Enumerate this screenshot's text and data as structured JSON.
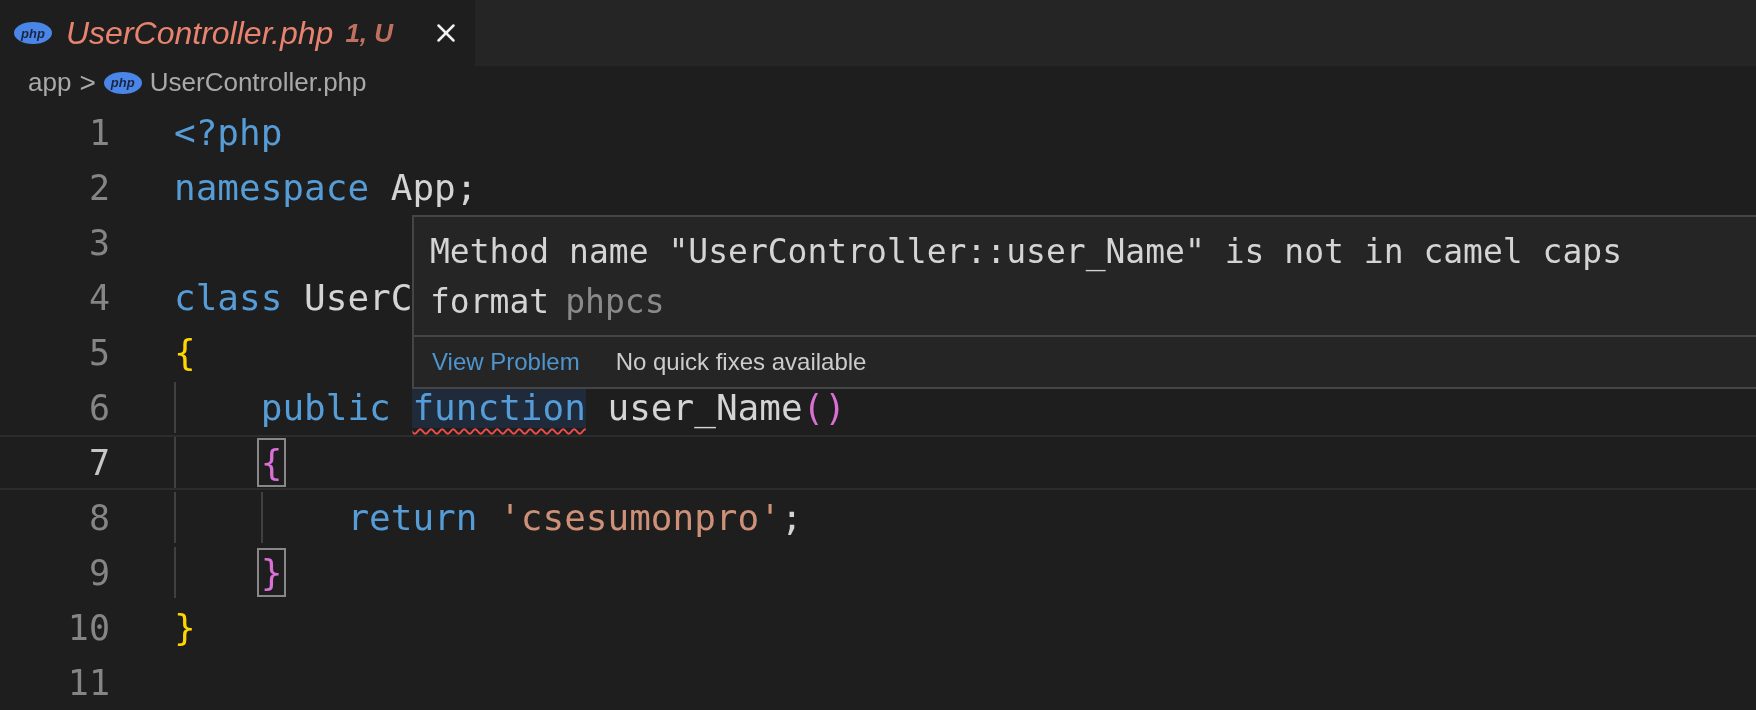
{
  "tab": {
    "icon_text": "php",
    "label": "UserController.php",
    "badge": "1, U",
    "selected": true
  },
  "breadcrumb": {
    "items": [
      {
        "label": "app",
        "kind": "folder"
      },
      {
        "label": "UserController.php",
        "kind": "file",
        "icon_text": "php"
      }
    ],
    "separator": ">"
  },
  "lines": [
    {
      "number": "1",
      "active": false,
      "tokens": [
        {
          "text": "<?php",
          "kind": "keyword"
        }
      ]
    },
    {
      "number": "2",
      "active": false,
      "tokens": [
        {
          "text": "namespace",
          "kind": "keyword"
        },
        {
          "text": " App;",
          "kind": "plain"
        }
      ]
    },
    {
      "number": "3",
      "active": false
    },
    {
      "number": "4",
      "active": false,
      "tokens": [
        {
          "text": "class",
          "kind": "keyword"
        },
        {
          "text": " UserC",
          "kind": "plain"
        }
      ]
    },
    {
      "number": "5",
      "active": false,
      "tokens": [
        {
          "text": "{",
          "kind": "brace-outer"
        }
      ]
    },
    {
      "number": "6",
      "active": false,
      "tokens": [
        {
          "text": "    public",
          "kind": "keyword"
        },
        {
          "text": " function",
          "kind": "keyword",
          "error": true
        },
        {
          "text": " user_Name",
          "kind": "plain"
        },
        {
          "text": "()",
          "kind": "brace-inner"
        }
      ]
    },
    {
      "number": "7",
      "active": true,
      "tokens": [
        {
          "text": "    {",
          "kind": "brace-inner",
          "matched": true
        }
      ]
    },
    {
      "number": "8",
      "active": false,
      "tokens": [
        {
          "text": "        return",
          "kind": "keyword"
        },
        {
          "text": " 'csesumonpro'",
          "kind": "string"
        },
        {
          "text": ";",
          "kind": "plain"
        }
      ]
    },
    {
      "number": "9",
      "active": false,
      "tokens": [
        {
          "text": "    }",
          "kind": "brace-inner",
          "matched": true
        }
      ]
    },
    {
      "number": "10",
      "active": false,
      "tokens": [
        {
          "text": "}",
          "kind": "brace-outer"
        }
      ]
    },
    {
      "number": "11",
      "active": false
    }
  ],
  "hover": {
    "message": "Method name \"UserController::user_Name\" is not in camel caps format",
    "source": "phpcs",
    "action": "View Problem",
    "note": "No quick fixes available"
  }
}
